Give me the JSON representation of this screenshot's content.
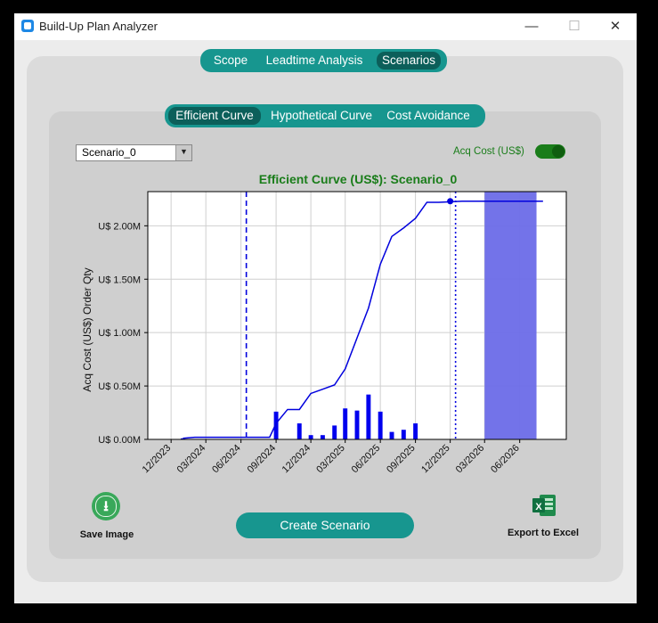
{
  "window": {
    "title": "Build-Up Plan Analyzer",
    "controls": {
      "minimize": "—",
      "maximize": "☐",
      "close": "✕"
    }
  },
  "top_tabs": [
    {
      "label": "Scope",
      "active": false
    },
    {
      "label": "Leadtime Analysis",
      "active": false
    },
    {
      "label": "Scenarios",
      "active": true
    }
  ],
  "sub_tabs": [
    {
      "label": "Efficient Curve",
      "active": true
    },
    {
      "label": "Hypothetical Curve",
      "active": false
    },
    {
      "label": "Cost Avoidance",
      "active": false
    }
  ],
  "scenario_select": {
    "value": "Scenario_0"
  },
  "toggle": {
    "label": "Acq Cost (US$)",
    "on": true
  },
  "chart_data": {
    "type": "line+bar",
    "title": "Efficient Curve (US$): Scenario_0",
    "ylabel": "Acq Cost (US$) Order Qty",
    "xlabel": "",
    "y_ticks": [
      "U$ 0.00M",
      "U$ 0.50M",
      "U$ 1.00M",
      "U$ 1.50M",
      "U$ 2.00M"
    ],
    "y_tick_values": [
      0,
      0.5,
      1.0,
      1.5,
      2.0
    ],
    "x_ticks": [
      "12/2023",
      "03/2024",
      "06/2024",
      "09/2024",
      "12/2024",
      "03/2025",
      "06/2025",
      "09/2025",
      "12/2025",
      "03/2026",
      "06/2026"
    ],
    "x_tick_dates": [
      "2023-12-01",
      "2024-03-01",
      "2024-06-01",
      "2024-09-01",
      "2024-12-01",
      "2025-03-01",
      "2025-06-01",
      "2025-09-01",
      "2025-12-01",
      "2026-03-01",
      "2026-06-01"
    ],
    "xlim": [
      "2023-10-01",
      "2026-10-01"
    ],
    "ylim": [
      0,
      2.32
    ],
    "grid": true,
    "series": [
      {
        "kind": "line",
        "x": [
          "2024-01-01",
          "2024-02-01",
          "2024-08-15",
          "2024-09-01",
          "2024-10-01",
          "2024-11-01",
          "2024-12-01",
          "2025-01-01",
          "2025-02-01",
          "2025-03-01",
          "2025-04-01",
          "2025-05-01",
          "2025-06-01",
          "2025-07-01",
          "2025-08-01",
          "2025-09-01",
          "2025-10-01",
          "2025-11-01",
          "2026-01-01",
          "2026-08-01"
        ],
        "values": [
          0.01,
          0.02,
          0.02,
          0.15,
          0.28,
          0.28,
          0.43,
          0.47,
          0.51,
          0.66,
          0.95,
          1.23,
          1.64,
          1.9,
          1.98,
          2.07,
          2.22,
          2.22,
          2.23,
          2.23
        ]
      },
      {
        "kind": "bar",
        "x": [
          "2024-01-01",
          "2024-09-01",
          "2024-11-01",
          "2024-12-01",
          "2025-01-01",
          "2025-02-01",
          "2025-03-01",
          "2025-04-01",
          "2025-05-01",
          "2025-06-01",
          "2025-07-01",
          "2025-08-01",
          "2025-09-01"
        ],
        "values": [
          0.01,
          0.26,
          0.15,
          0.04,
          0.04,
          0.13,
          0.29,
          0.27,
          0.42,
          0.26,
          0.07,
          0.09,
          0.15
        ]
      }
    ],
    "marker": {
      "x": "2025-12-01",
      "y": 2.23
    },
    "vlines": [
      {
        "x": "2024-06-15",
        "style": "dashed"
      },
      {
        "x": "2025-12-15",
        "style": "dotted"
      }
    ],
    "shaded_range": {
      "from": "2026-03-01",
      "to": "2026-07-15"
    },
    "colors": {
      "line": "#0000dd",
      "bar": "#0000ee",
      "shade": "#6b6be8",
      "title": "#1a7d1a"
    }
  },
  "actions": {
    "save_image": "Save Image",
    "create": "Create Scenario",
    "export": "Export to Excel"
  },
  "icons": {
    "save": "download-icon",
    "excel": "excel-icon"
  }
}
